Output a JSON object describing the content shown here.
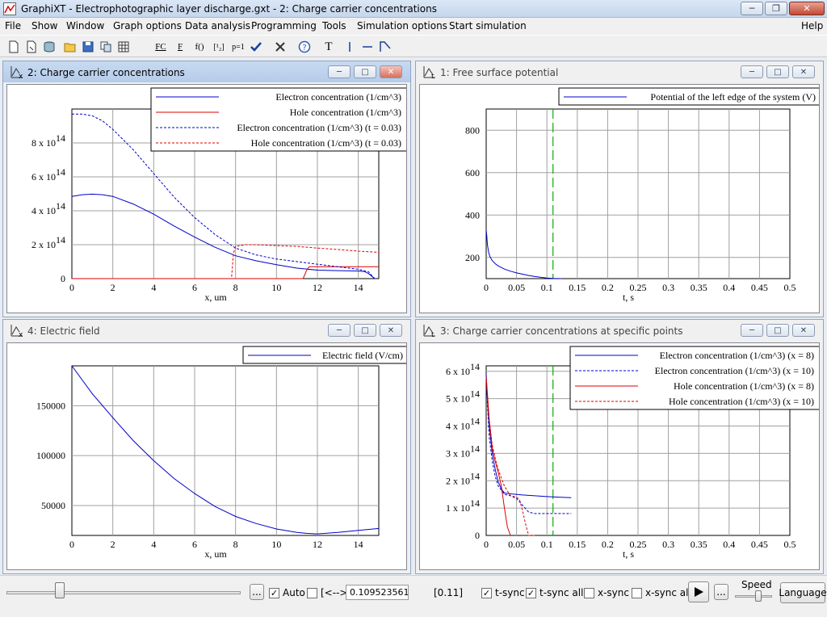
{
  "window": {
    "title": "GraphiXT - Electrophotographic layer discharge.gxt - 2: Charge carrier concentrations"
  },
  "menu": [
    "File",
    "Show",
    "Window",
    "Graph options",
    "Data analysis",
    "Programming",
    "Tools",
    "Simulation options",
    "Start simulation"
  ],
  "menu_help": "Help",
  "toolbar": {
    "fc_label": "FC",
    "f_label": "F",
    "fparen_label": "f()",
    "matrix_label": "[¹₂]",
    "p1_label": "p=1",
    "text_label": "T"
  },
  "colors": {
    "blue": "#0000cc",
    "red": "#dd0000",
    "green": "#00b000",
    "grid": "#a0a0a0"
  },
  "panes": [
    {
      "id": "2",
      "title": "2: Charge carrier concentrations",
      "icon": "graph-x-icon",
      "active": true
    },
    {
      "id": "1",
      "title": "1: Free surface potential",
      "icon": "graph-t-icon",
      "active": false
    },
    {
      "id": "4",
      "title": "4: Electric field",
      "icon": "graph-x-icon",
      "active": false
    },
    {
      "id": "3",
      "title": "3: Charge carrier concentrations at specific points",
      "icon": "graph-t-icon",
      "active": false
    }
  ],
  "chart_data": [
    {
      "type": "line",
      "xlabel": "x, um",
      "xlim": [
        0,
        15
      ],
      "ylim": [
        0,
        1000000000000000.0
      ],
      "xticks": [
        "0",
        "2",
        "4",
        "6",
        "8",
        "10",
        "12",
        "14"
      ],
      "yticks": [
        {
          "v": 0,
          "t": "0"
        },
        {
          "v": 200000000000000.0,
          "t": "2 x 10",
          "e": "14"
        },
        {
          "v": 400000000000000.0,
          "t": "4 x 10",
          "e": "14"
        },
        {
          "v": 600000000000000.0,
          "t": "6 x 10",
          "e": "14"
        },
        {
          "v": 800000000000000.0,
          "t": "8 x 10",
          "e": "14"
        }
      ],
      "legend_position": "top-right",
      "series": [
        {
          "name": "Electron concentration (1/cm^3)",
          "color": "#0000cc",
          "dash": false,
          "x": [
            0,
            0.5,
            1,
            1.5,
            2,
            3,
            4,
            5,
            6,
            7,
            8,
            9,
            10,
            11,
            12,
            13,
            14,
            14.3,
            14.5,
            14.8
          ],
          "y": [
            485000000000000.0,
            495000000000000.0,
            498000000000000.0,
            495000000000000.0,
            485000000000000.0,
            440000000000000.0,
            380000000000000.0,
            310000000000000.0,
            245000000000000.0,
            185000000000000.0,
            135000000000000.0,
            105000000000000.0,
            82000000000000.0,
            62000000000000.0,
            50000000000000.0,
            47000000000000.0,
            45000000000000.0,
            42000000000000.0,
            30000000000000.0,
            0
          ]
        },
        {
          "name": "Hole concentration (1/cm^3)",
          "color": "#dd0000",
          "dash": false,
          "x": [
            0,
            11.3,
            11.5,
            11.6,
            12,
            13,
            14,
            14.5,
            15
          ],
          "y": [
            0,
            0,
            55000000000000.0,
            70000000000000.0,
            70000000000000.0,
            70000000000000.0,
            70000000000000.0,
            70000000000000.0,
            70000000000000.0
          ]
        },
        {
          "name": "Electron concentration (1/cm^3) (t = 0.03)",
          "color": "#0000cc",
          "dash": true,
          "x": [
            0,
            0.5,
            1,
            1.5,
            2,
            3,
            4,
            5,
            6,
            7,
            8,
            9,
            10,
            11,
            12,
            13,
            14,
            14.5,
            14.8
          ],
          "y": [
            970000000000000.0,
            970000000000000.0,
            960000000000000.0,
            930000000000000.0,
            880000000000000.0,
            760000000000000.0,
            620000000000000.0,
            480000000000000.0,
            360000000000000.0,
            260000000000000.0,
            180000000000000.0,
            140000000000000.0,
            115000000000000.0,
            100000000000000.0,
            85000000000000.0,
            70000000000000.0,
            55000000000000.0,
            40000000000000.0,
            0
          ]
        },
        {
          "name": "Hole concentration (1/cm^3) (t = 0.03)",
          "color": "#dd0000",
          "dash": true,
          "x": [
            0,
            7.8,
            7.9,
            8,
            8.5,
            9,
            10,
            11,
            12,
            13,
            14,
            15
          ],
          "y": [
            0,
            0,
            150000000000000.0,
            190000000000000.0,
            200000000000000.0,
            200000000000000.0,
            195000000000000.0,
            190000000000000.0,
            180000000000000.0,
            172000000000000.0,
            162000000000000.0,
            155000000000000.0
          ]
        }
      ]
    },
    {
      "type": "line",
      "xlabel": "t, s",
      "xlim": [
        0,
        0.5
      ],
      "ylim": [
        100,
        900
      ],
      "xticks": [
        "0",
        "0.05",
        "0.1",
        "0.15",
        "0.2",
        "0.25",
        "0.3",
        "0.35",
        "0.4",
        "0.45",
        "0.5"
      ],
      "yticks": [
        {
          "v": 200,
          "t": "200"
        },
        {
          "v": 400,
          "t": "400"
        },
        {
          "v": 600,
          "t": "600"
        },
        {
          "v": 800,
          "t": "800"
        }
      ],
      "vline": 0.11,
      "legend_position": "top-right",
      "series": [
        {
          "name": "Potential of the left edge of the system (V)",
          "color": "#0000cc",
          "dash": false,
          "x": [
            0,
            0.001,
            0.002,
            0.004,
            0.006,
            0.01,
            0.015,
            0.02,
            0.03,
            0.04,
            0.05,
            0.06,
            0.07,
            0.08,
            0.09,
            0.1,
            0.11,
            0.125
          ],
          "y": [
            330,
            300,
            260,
            225,
            205,
            185,
            170,
            160,
            145,
            135,
            127,
            121,
            115,
            110,
            106,
            103,
            101,
            100
          ]
        }
      ]
    },
    {
      "type": "line",
      "xlabel": "x, um",
      "xlim": [
        0,
        15
      ],
      "ylim": [
        20000,
        190000
      ],
      "xticks": [
        "0",
        "2",
        "4",
        "6",
        "8",
        "10",
        "12",
        "14"
      ],
      "yticks": [
        {
          "v": 50000,
          "t": "50000"
        },
        {
          "v": 100000,
          "t": "100000"
        },
        {
          "v": 150000,
          "t": "150000"
        }
      ],
      "legend_position": "top-right",
      "series": [
        {
          "name": "Electric field (V/cm)",
          "color": "#0000cc",
          "dash": false,
          "x": [
            0,
            1,
            2,
            3,
            4,
            5,
            6,
            7,
            8,
            9,
            10,
            11,
            11.5,
            12,
            13,
            14,
            15
          ],
          "y": [
            190000,
            162000,
            138000,
            115000,
            95000,
            77000,
            62000,
            49000,
            39000,
            32000,
            26500,
            23000,
            22000,
            21500,
            23000,
            25000,
            27000
          ]
        }
      ]
    },
    {
      "type": "line",
      "xlabel": "t, s",
      "xlim": [
        0,
        0.5
      ],
      "ylim": [
        0,
        620000000000000.0
      ],
      "xticks": [
        "0",
        "0.05",
        "0.1",
        "0.15",
        "0.2",
        "0.25",
        "0.3",
        "0.35",
        "0.4",
        "0.45",
        "0.5"
      ],
      "yticks": [
        {
          "v": 0,
          "t": "0"
        },
        {
          "v": 100000000000000.0,
          "t": "1 x 10",
          "e": "14"
        },
        {
          "v": 200000000000000.0,
          "t": "2 x 10",
          "e": "14"
        },
        {
          "v": 300000000000000.0,
          "t": "3 x 10",
          "e": "14"
        },
        {
          "v": 400000000000000.0,
          "t": "4 x 10",
          "e": "14"
        },
        {
          "v": 500000000000000.0,
          "t": "5 x 10",
          "e": "14"
        },
        {
          "v": 600000000000000.0,
          "t": "6 x 10",
          "e": "14"
        }
      ],
      "vline": 0.11,
      "legend_position": "top-right",
      "series": [
        {
          "name": "Electron concentration (1/cm^3) (x = 8)",
          "color": "#0000cc",
          "dash": false,
          "x": [
            0,
            0.002,
            0.005,
            0.01,
            0.015,
            0.02,
            0.025,
            0.03,
            0.04,
            0.06,
            0.08,
            0.1,
            0.12,
            0.14
          ],
          "y": [
            590000000000000.0,
            500000000000000.0,
            400000000000000.0,
            300000000000000.0,
            240000000000000.0,
            195000000000000.0,
            170000000000000.0,
            155000000000000.0,
            152000000000000.0,
            148000000000000.0,
            145000000000000.0,
            142000000000000.0,
            140000000000000.0,
            138000000000000.0
          ]
        },
        {
          "name": "Electron concentration (1/cm^3) (x = 10)",
          "color": "#0000cc",
          "dash": true,
          "x": [
            0,
            0.002,
            0.005,
            0.01,
            0.015,
            0.02,
            0.03,
            0.04,
            0.05,
            0.06,
            0.07,
            0.08,
            0.1,
            0.12,
            0.14
          ],
          "y": [
            580000000000000.0,
            480000000000000.0,
            360000000000000.0,
            270000000000000.0,
            215000000000000.0,
            180000000000000.0,
            150000000000000.0,
            145000000000000.0,
            135000000000000.0,
            110000000000000.0,
            85000000000000.0,
            80000000000000.0,
            80000000000000.0,
            80000000000000.0,
            80000000000000.0
          ]
        },
        {
          "name": "Hole concentration (1/cm^3) (x = 8)",
          "color": "#dd0000",
          "dash": false,
          "x": [
            0,
            0.002,
            0.005,
            0.01,
            0.015,
            0.02,
            0.025,
            0.03,
            0.035,
            0.04
          ],
          "y": [
            580000000000000.0,
            520000000000000.0,
            420000000000000.0,
            320000000000000.0,
            270000000000000.0,
            230000000000000.0,
            180000000000000.0,
            100000000000000.0,
            30000000000000.0,
            0
          ]
        },
        {
          "name": "Hole concentration (1/cm^3) (x = 10)",
          "color": "#dd0000",
          "dash": true,
          "x": [
            0,
            0.002,
            0.005,
            0.01,
            0.015,
            0.02,
            0.03,
            0.04,
            0.05,
            0.055,
            0.06,
            0.065,
            0.07,
            0.08
          ],
          "y": [
            580000000000000.0,
            510000000000000.0,
            420000000000000.0,
            330000000000000.0,
            280000000000000.0,
            240000000000000.0,
            180000000000000.0,
            145000000000000.0,
            140000000000000.0,
            130000000000000.0,
            90000000000000.0,
            40000000000000.0,
            0,
            0
          ]
        }
      ]
    }
  ],
  "bottom": {
    "auto_label": "Auto",
    "range_label": "[<-->]",
    "time_value": "0.109523561",
    "range_value": "[0.11]",
    "tsync_label": "t-sync",
    "tsyncall_label": "t-sync all",
    "xsync_label": "x-sync",
    "xsyncall_label": "x-sync all",
    "dots_label": "...",
    "speed_label": "Speed",
    "language_label": "Language"
  }
}
